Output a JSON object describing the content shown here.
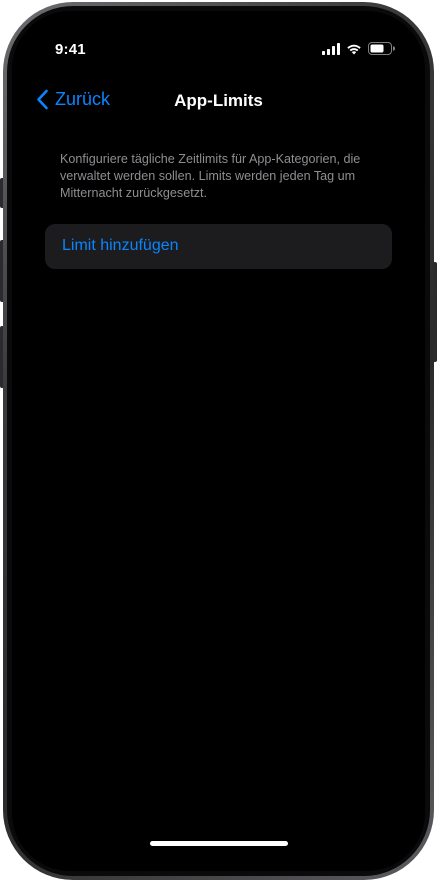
{
  "status_bar": {
    "time": "9:41",
    "icons": [
      "cellular-signal-icon",
      "wifi-icon",
      "battery-icon"
    ]
  },
  "nav": {
    "back_label": "Zurück",
    "title": "App-Limits"
  },
  "description": "Konfiguriere tägliche Zeitlimits für App-Kategorien, die verwaltet werden sollen. Limits werden jeden Tag um Mitternacht zurückgesetzt.",
  "actions": {
    "add_limit_label": "Limit hinzufügen"
  },
  "colors": {
    "accent": "#0a84ff",
    "background": "#000000",
    "cell_background": "#1c1c1e",
    "secondary_text": "#8e8e93"
  }
}
